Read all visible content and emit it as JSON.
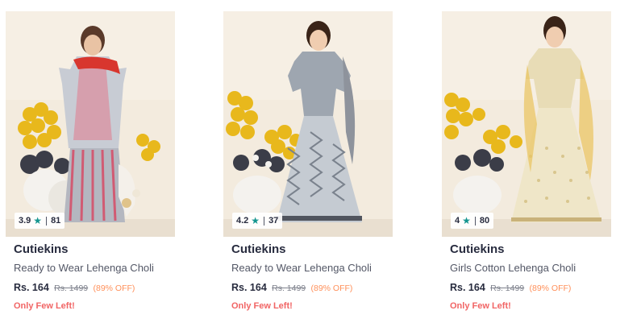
{
  "products": [
    {
      "brand": "Cutiekins",
      "name": "Ready to Wear Lehenga Choli",
      "rating": "3.9",
      "rating_count": "81",
      "price": "Rs. 164",
      "mrp": "Rs. 1499",
      "discount": "(89% OFF)",
      "stock_note": "Only Few Left!",
      "star_icon": "star-icon"
    },
    {
      "brand": "Cutiekins",
      "name": "Ready to Wear Lehenga Choli",
      "rating": "4.2",
      "rating_count": "37",
      "price": "Rs. 164",
      "mrp": "Rs. 1499",
      "discount": "(89% OFF)",
      "stock_note": "Only Few Left!",
      "star_icon": "star-icon"
    },
    {
      "brand": "Cutiekins",
      "name": "Girls Cotton Lehenga Choli",
      "rating": "4",
      "rating_count": "80",
      "price": "Rs. 164",
      "mrp": "Rs. 1499",
      "discount": "(89% OFF)",
      "stock_note": "Only Few Left!",
      "star_icon": "star-icon"
    }
  ],
  "colors": {
    "star": "#14958f",
    "discount": "#ff905a",
    "stock": "#f16565",
    "text_primary": "#282c3f",
    "text_secondary": "#535766"
  }
}
